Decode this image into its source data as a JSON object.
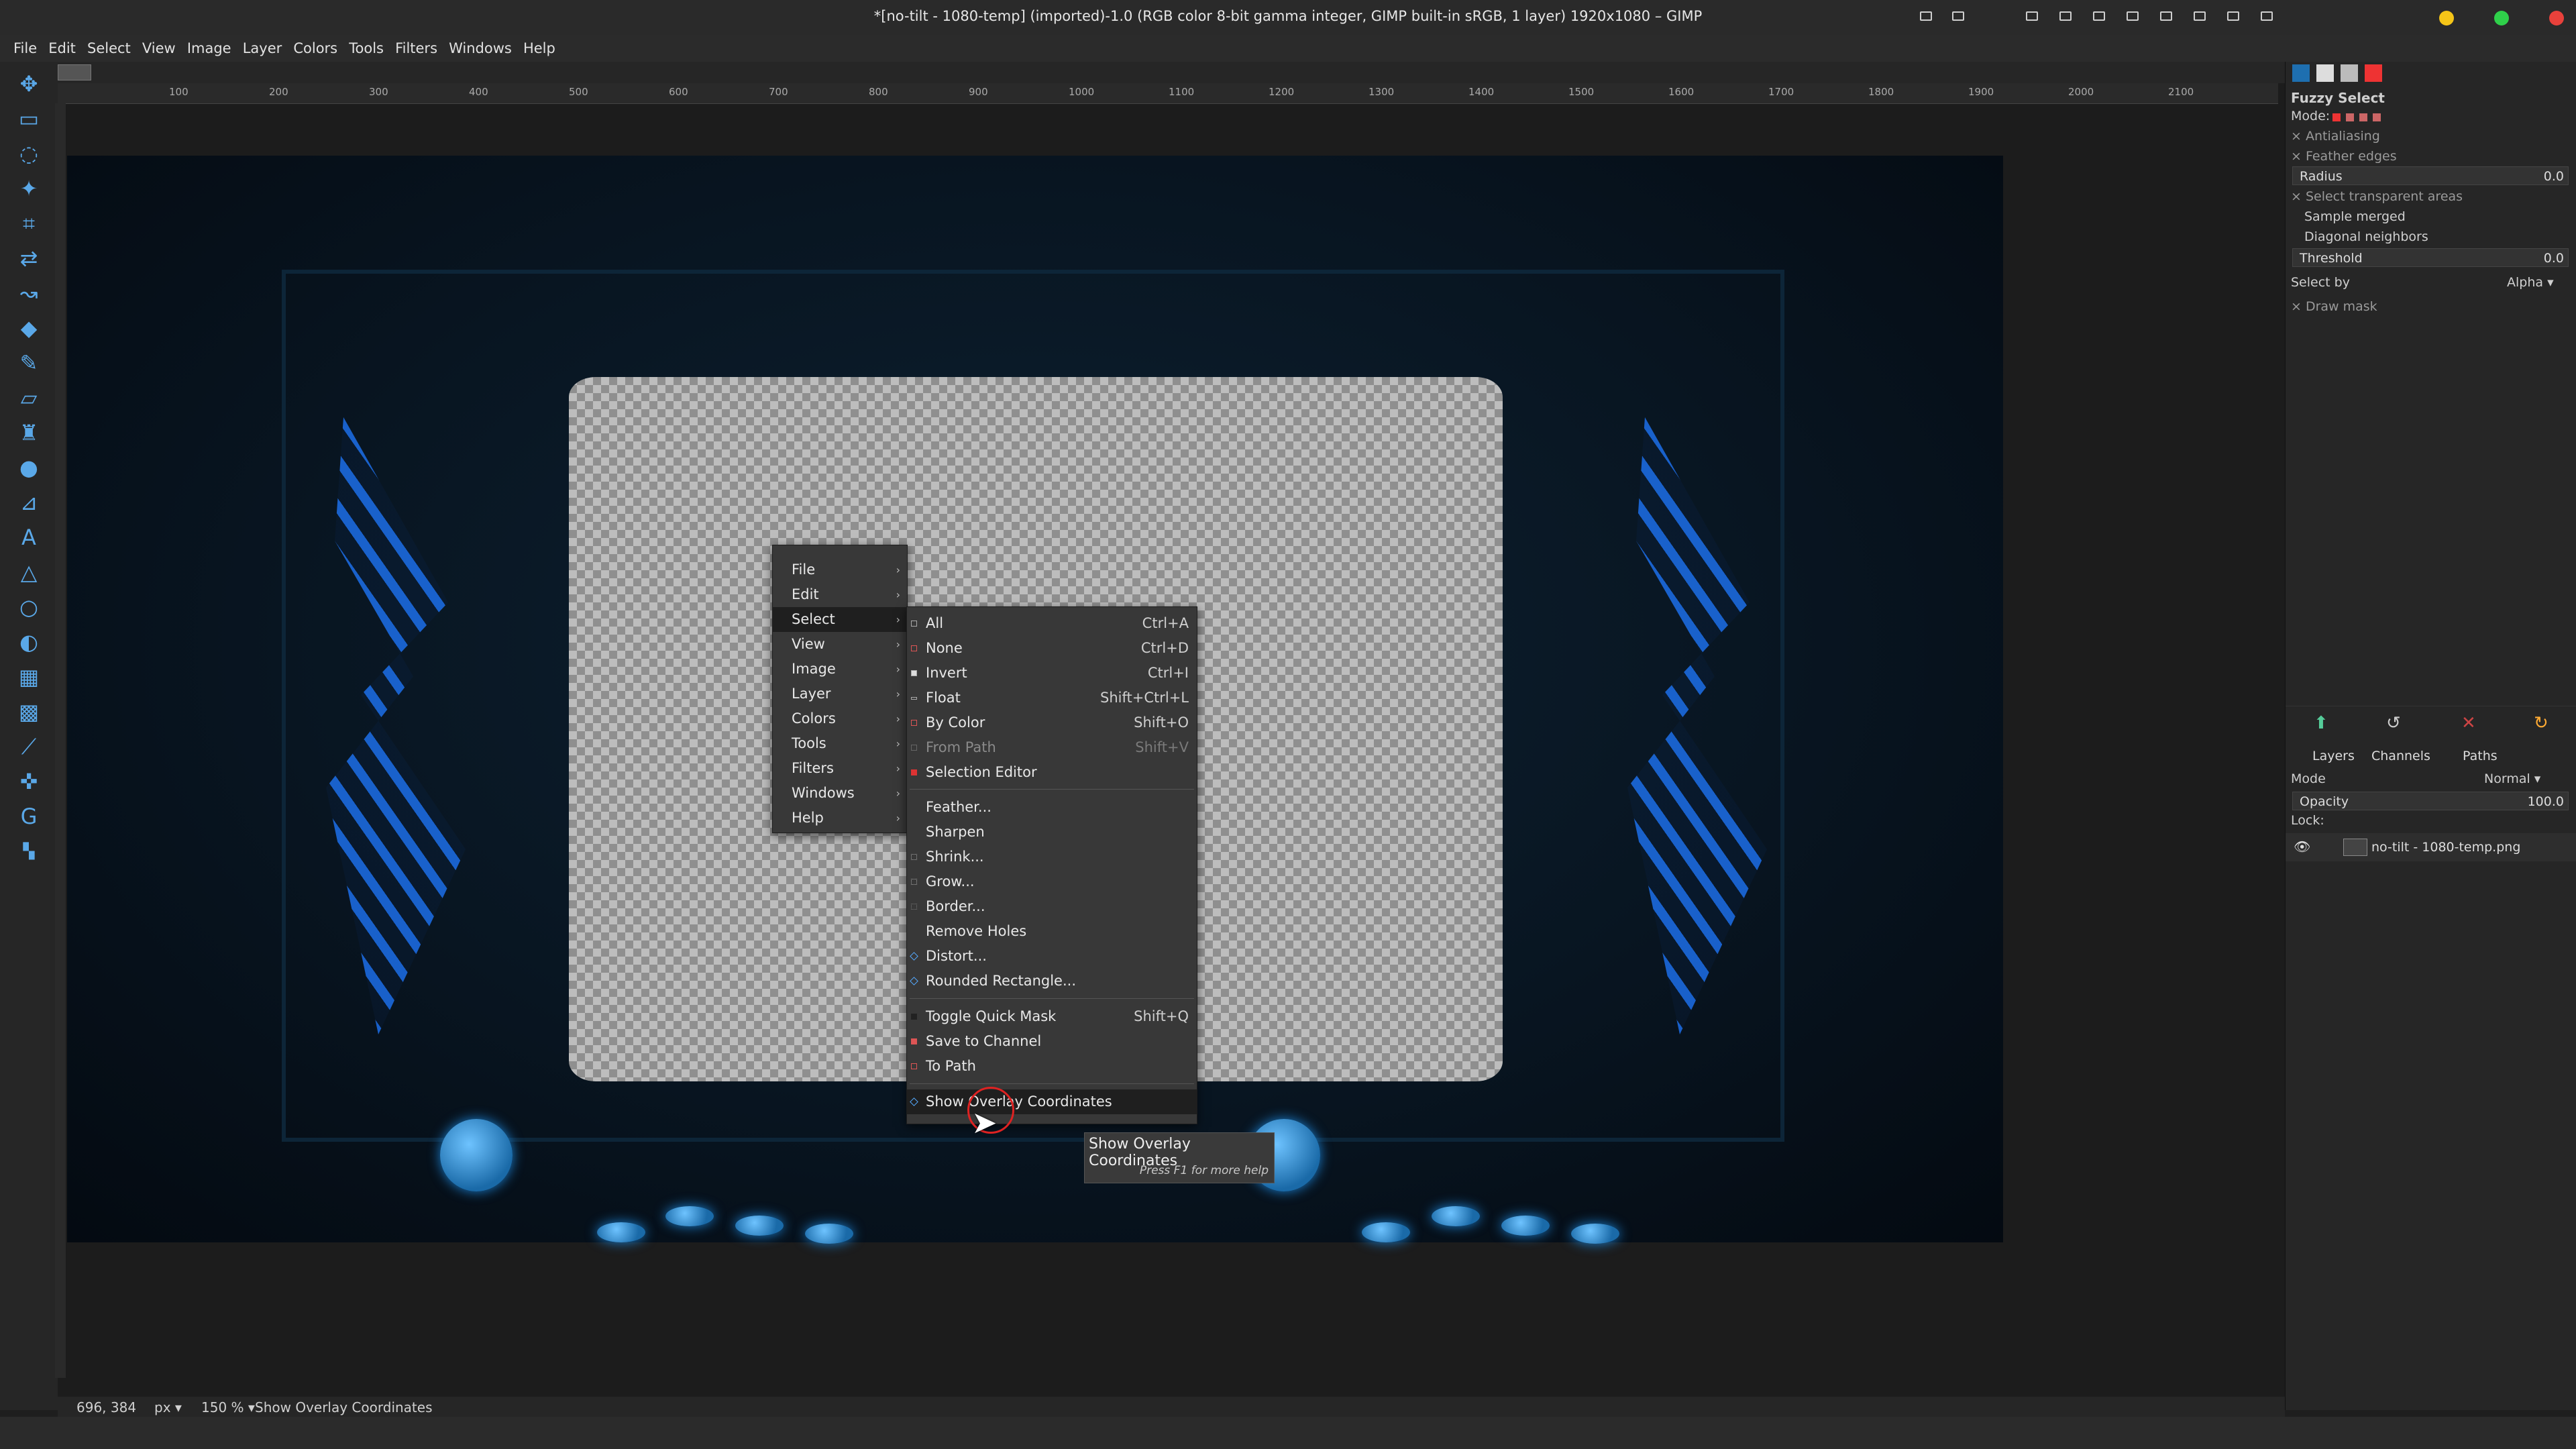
{
  "window": {
    "title": "*[no-tilt - 1080-temp] (imported)-1.0 (RGB color 8-bit gamma integer, GIMP built-in sRGB, 1 layer) 1920x1080 – GIMP"
  },
  "menubar": [
    "File",
    "Edit",
    "Select",
    "View",
    "Image",
    "Layer",
    "Colors",
    "Tools",
    "Filters",
    "Windows",
    "Help"
  ],
  "ruler_ticks": [
    "100",
    "200",
    "300",
    "400",
    "500",
    "600",
    "700",
    "800",
    "900",
    "1000",
    "1100",
    "1200",
    "1300",
    "1400",
    "1500",
    "1600",
    "1700",
    "1800",
    "1900",
    "2000",
    "2100"
  ],
  "tool_options": {
    "title": "Fuzzy Select",
    "mode_label": "Mode:",
    "antialiasing": "Antialiasing",
    "feather_edges": "Feather edges",
    "radius_label": "Radius",
    "radius_value": "0.0",
    "select_transparent": "Select transparent areas",
    "sample_merged": "Sample merged",
    "diagonal_neighbors": "Diagonal neighbors",
    "threshold_label": "Threshold",
    "threshold_value": "0.0",
    "select_by_label": "Select by",
    "select_by_value": "Alpha",
    "draw_mask": "Draw mask"
  },
  "layers_panel": {
    "tabs": [
      "Layers",
      "Channels",
      "Paths"
    ],
    "mode_label": "Mode",
    "mode_value": "Normal",
    "opacity_label": "Opacity",
    "opacity_value": "100.0",
    "lock_label": "Lock:",
    "layer_name": "no-tilt - 1080-temp.png"
  },
  "context_menu": {
    "items": [
      "File",
      "Edit",
      "Select",
      "View",
      "Image",
      "Layer",
      "Colors",
      "Tools",
      "Filters",
      "Windows",
      "Help"
    ],
    "highlighted": "Select"
  },
  "select_submenu": {
    "group1": [
      {
        "label": "All",
        "shortcut": "Ctrl+A"
      },
      {
        "label": "None",
        "shortcut": "Ctrl+D"
      },
      {
        "label": "Invert",
        "shortcut": "Ctrl+I"
      },
      {
        "label": "Float",
        "shortcut": "Shift+Ctrl+L"
      },
      {
        "label": "By Color",
        "shortcut": "Shift+O"
      },
      {
        "label": "From Path",
        "shortcut": "Shift+V"
      },
      {
        "label": "Selection Editor",
        "shortcut": ""
      }
    ],
    "group2": [
      "Feather...",
      "Sharpen",
      "Shrink...",
      "Grow...",
      "Border...",
      "Remove Holes",
      "Distort...",
      "Rounded Rectangle..."
    ],
    "group3": [
      {
        "label": "Toggle Quick Mask",
        "shortcut": "Shift+Q"
      },
      {
        "label": "Save to Channel",
        "shortcut": ""
      },
      {
        "label": "To Path",
        "shortcut": ""
      }
    ],
    "group4": [
      "Show Overlay Coordinates"
    ]
  },
  "tooltip": {
    "title": "Show Overlay Coordinates",
    "hint": "Press F1 for more help"
  },
  "statusbar": {
    "coords": "696, 384",
    "unit": "px",
    "zoom": "150 %",
    "message": "Show Overlay Coordinates"
  },
  "colors": {
    "accent": "#1f8fff",
    "menu_bg": "#383838",
    "menu_highlight": "#1f1f1f"
  }
}
